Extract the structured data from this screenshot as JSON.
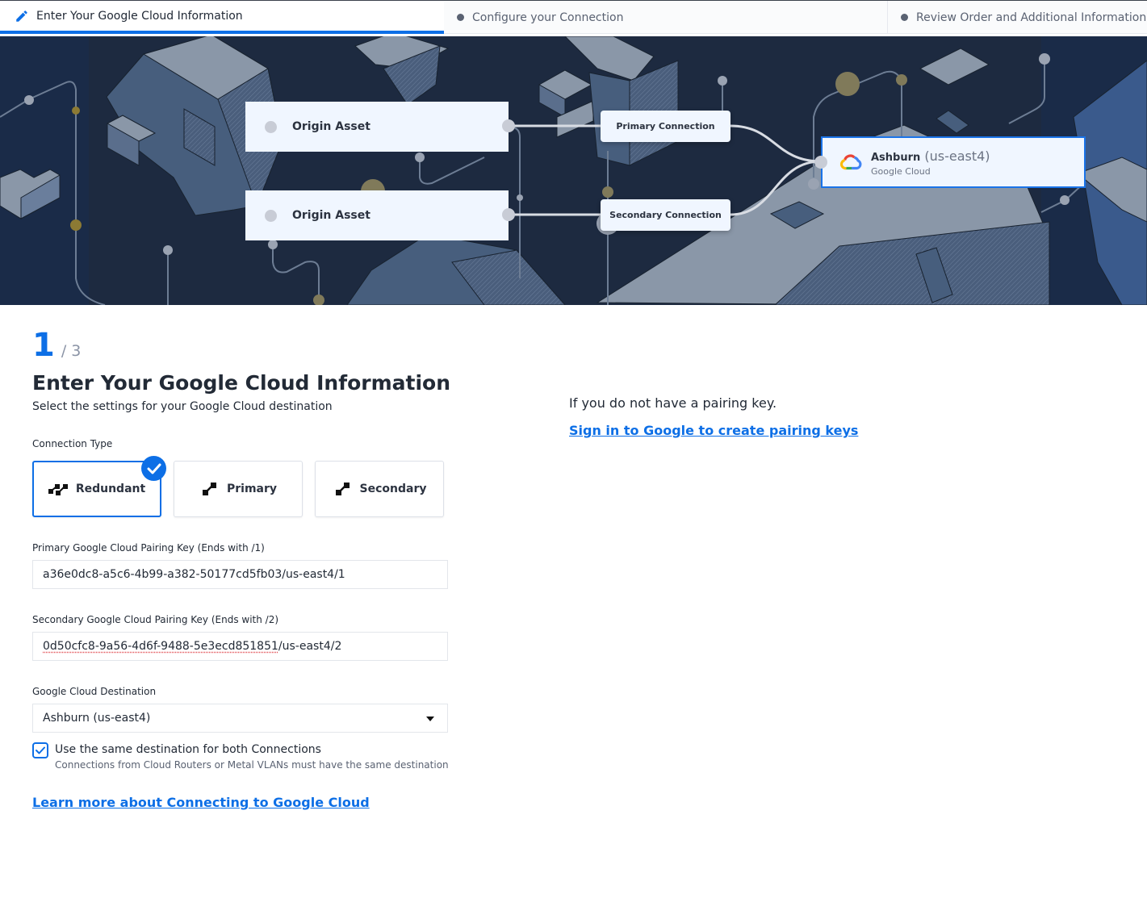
{
  "stepper": {
    "steps": [
      {
        "label": "Enter Your Google Cloud Information",
        "state": "active",
        "icon": "pencil-icon"
      },
      {
        "label": "Configure your Connection",
        "state": "pending",
        "icon": "dot-icon"
      },
      {
        "label": "Review Order and Additional Information",
        "state": "pending",
        "icon": "dot-icon"
      }
    ],
    "accent": "#0d6fe6"
  },
  "diagram": {
    "origins": [
      {
        "label": "Origin Asset"
      },
      {
        "label": "Origin Asset"
      }
    ],
    "connections": [
      {
        "label": "Primary Connection"
      },
      {
        "label": "Secondary Connection"
      }
    ],
    "destination": {
      "name": "Ashburn",
      "region": "(us-east4)",
      "provider": "Google Cloud",
      "icon": "google-cloud-icon"
    }
  },
  "progress": {
    "current": "1",
    "total": "/ 3"
  },
  "page": {
    "title": "Enter Your Google Cloud Information",
    "subtitle": "Select the settings for your Google Cloud destination"
  },
  "connection_type": {
    "label": "Connection Type",
    "options": [
      {
        "label": "Redundant",
        "icon": "redundant-connection-icon",
        "selected": true
      },
      {
        "label": "Primary",
        "icon": "single-connection-icon",
        "selected": false
      },
      {
        "label": "Secondary",
        "icon": "single-connection-icon",
        "selected": false
      }
    ]
  },
  "form": {
    "primary_key": {
      "label": "Primary Google Cloud Pairing Key (Ends with /1)",
      "value": "a36e0dc8-a5c6-4b99-a382-50177cd5fb03/us-east4/1"
    },
    "secondary_key": {
      "label": "Secondary Google Cloud Pairing Key (Ends with /2)",
      "value_flagged": "0d50cfc8-9a56-4d6f-9488-5e3ecd851851",
      "value_rest": "/us-east4/2"
    },
    "destination": {
      "label": "Google Cloud Destination",
      "selected": "Ashburn (us-east4)"
    },
    "same_destination": {
      "label": "Use the same destination for both Connections",
      "help": "Connections from Cloud Routers or Metal VLANs must have the same destination",
      "checked": true
    }
  },
  "links": {
    "learn_more": "Learn more about Connecting to Google Cloud",
    "sign_in": "Sign in to Google to create pairing keys"
  },
  "side": {
    "no_key_text": "If you do not have a pairing key."
  }
}
